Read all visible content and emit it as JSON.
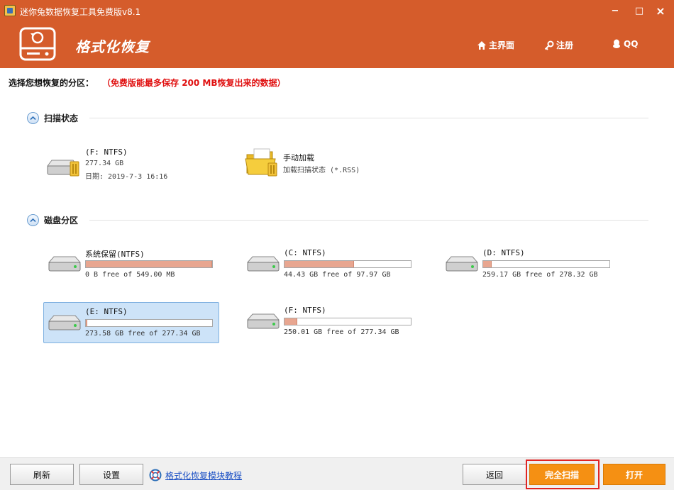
{
  "window": {
    "title": "迷你兔数据恢复工具免费版v8.1",
    "minimize": "−",
    "maximize": "□",
    "close": "×"
  },
  "header": {
    "page_title": "格式化恢复",
    "nav": {
      "home": "主界面",
      "register": "注册",
      "qq": "QQ"
    }
  },
  "prompt": {
    "label": "选择您想恢复的分区：",
    "notice": "（免费版能最多保存 200 MB恢复出来的数据）"
  },
  "sections": {
    "scan_state": "扫描状态",
    "disk_partitions": "磁盘分区"
  },
  "scan_items": [
    {
      "name": "(F: NTFS)",
      "size": "277.34 GB",
      "date": "日期: 2019-7-3 16:16"
    },
    {
      "name": "手动加载",
      "description": "加载扫描状态 (*.RSS)"
    }
  ],
  "partitions": [
    {
      "name": "系统保留(NTFS)",
      "info": "0 B free of 549.00 MB",
      "used_fraction": 1.0,
      "selected": false
    },
    {
      "name": "(C: NTFS)",
      "info": "44.43 GB free of 97.97 GB",
      "used_fraction": 0.55,
      "selected": false
    },
    {
      "name": "(D: NTFS)",
      "info": "259.17 GB free of 278.32 GB",
      "used_fraction": 0.07,
      "selected": false
    },
    {
      "name": "(E: NTFS)",
      "info": "273.58 GB free of 277.34 GB",
      "used_fraction": 0.014,
      "selected": true
    },
    {
      "name": "(F: NTFS)",
      "info": "250.01 GB free of 277.34 GB",
      "used_fraction": 0.1,
      "selected": false
    }
  ],
  "footer": {
    "refresh": "刷新",
    "settings": "设置",
    "tutorial": "格式化恢复模块教程",
    "back": "返回",
    "full_scan": "完全扫描",
    "open": "打开"
  },
  "colors": {
    "header": "#d55c2b",
    "accent_button": "#f59013",
    "notice": "#e01010",
    "selected": "#cde3f8",
    "bar_fill": "#e8a690"
  }
}
